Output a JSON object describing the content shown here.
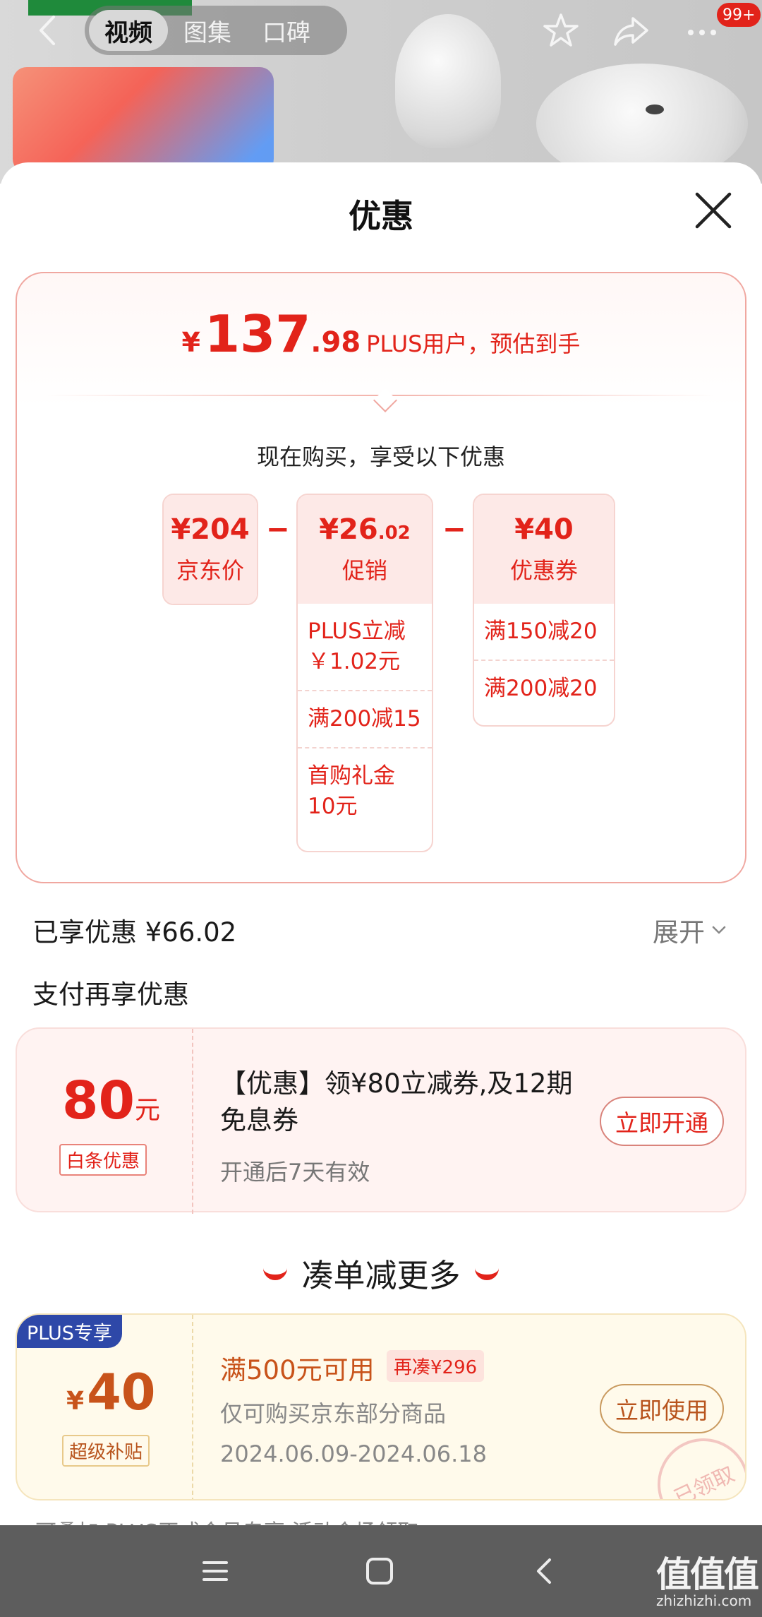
{
  "header": {
    "tabs": [
      {
        "label": "视频",
        "active": true
      },
      {
        "label": "图集",
        "active": false
      },
      {
        "label": "口碑",
        "active": false
      }
    ],
    "notification_badge": "99+",
    "icons": [
      "back-icon",
      "star-icon",
      "share-icon",
      "more-icon"
    ]
  },
  "sheet": {
    "title": "优惠",
    "close_icon": "close-icon"
  },
  "price_card": {
    "currency": "¥",
    "price_int": "137",
    "price_dec": ".98",
    "price_note": "PLUS用户，预估到手",
    "enjoy_text": "现在购买，享受以下优惠",
    "minus": "−",
    "jd_price": {
      "amount": "¥204",
      "label": "京东价"
    },
    "promo": {
      "amount_main": "¥26",
      "amount_dec": ".02",
      "label": "促销",
      "items": [
        "PLUS立减￥1.02元",
        "满200减15",
        "首购礼金10元"
      ]
    },
    "coupon": {
      "amount": "¥40",
      "label": "优惠券",
      "items": [
        "满150减20",
        "满200减20"
      ]
    }
  },
  "saved": {
    "text": "已享优惠 ¥66.02",
    "expand": "展开"
  },
  "payment": {
    "title": "支付再享优惠",
    "amount": "80",
    "unit": "元",
    "tag": "白条优惠",
    "desc": "【优惠】领¥80立减券,及12期免息券",
    "sub": "开通后7天有效",
    "button": "立即开通"
  },
  "more": {
    "title": "凑单减更多"
  },
  "plus_coupon": {
    "tag": "PLUS专享",
    "currency": "¥",
    "amount": "40",
    "sub": "超级补贴",
    "title": "满500元可用",
    "chip": "再凑¥296",
    "desc": "仅可购买京东部分商品",
    "date": "2024.06.09-2024.06.18",
    "button": "立即使用",
    "stamp": "已领取"
  },
  "cut_row": "可叠加   PLUS正式会员专享   活动会场领取",
  "system_nav": {
    "icons": [
      "menu-icon",
      "home-icon",
      "back-icon"
    ]
  },
  "watermark": {
    "main": "值值值",
    "sub": "zhizhizhi.com"
  },
  "colors": {
    "accent": "#e2231a",
    "plus_blue": "#2e48a8",
    "gold": "#c8531a"
  }
}
